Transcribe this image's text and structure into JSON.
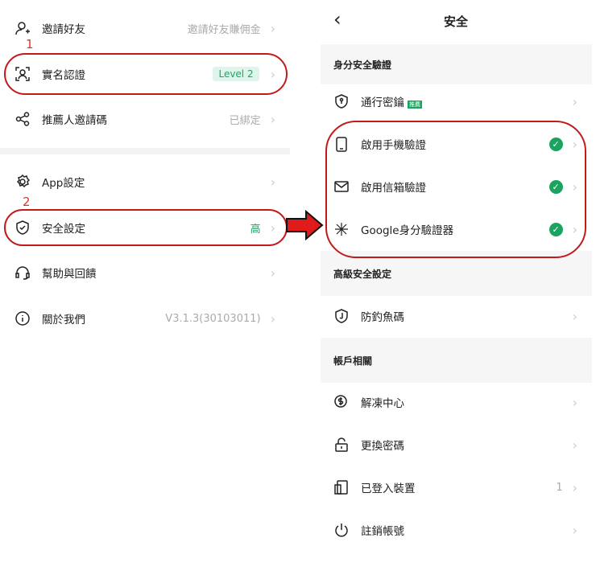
{
  "left": {
    "items": [
      {
        "label": "邀請好友",
        "value": "邀請好友賺佣金"
      },
      {
        "label": "實名認證",
        "badge": "Level 2"
      },
      {
        "label": "推薦人邀請碼",
        "value": "已綁定"
      },
      {
        "label": "App設定"
      },
      {
        "label": "安全設定",
        "value": "高"
      },
      {
        "label": "幫助與回饋"
      },
      {
        "label": "關於我們",
        "value": "V3.1.3(30103011)"
      }
    ]
  },
  "annotations": {
    "n1": "1",
    "n2": "2"
  },
  "right": {
    "title": "安全",
    "back": "‹",
    "sections": [
      "身分安全驗證",
      "高級安全設定",
      "帳戶相關"
    ],
    "items": [
      {
        "label": "通行密鑰",
        "tag": "推薦"
      },
      {
        "label": "啟用手機驗證"
      },
      {
        "label": "啟用信箱驗證"
      },
      {
        "label": "Google身分驗證器"
      },
      {
        "label": "防釣魚碼"
      },
      {
        "label": "解凍中心"
      },
      {
        "label": "更換密碼"
      },
      {
        "label": "已登入裝置",
        "value": "1"
      },
      {
        "label": "註銷帳號"
      }
    ]
  },
  "chevron": "›",
  "check": "✓",
  "accent": "#1ba35f",
  "annotation_color": "#c21a1a"
}
